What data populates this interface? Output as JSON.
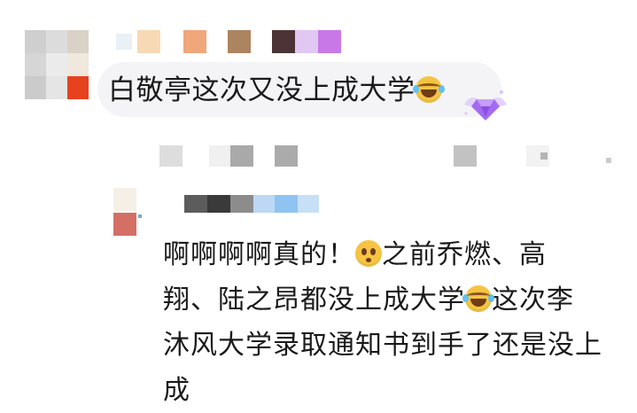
{
  "comment": {
    "text": "白敬亭这次又没上成大学",
    "emoji": "laugh-cry-emoji"
  },
  "reply": {
    "lines": [
      [
        "啊啊啊啊真的！",
        "之前乔燃、高"
      ],
      [
        "翔、陆之昂都没上成大学",
        "这次李"
      ],
      [
        "沐风大学录取通知书到手了还是没上"
      ],
      [
        "成"
      ]
    ]
  },
  "colors": {
    "bubble_bg": "#f4f4f7",
    "text": "#1a1a1a",
    "emoji_yellow": "#f6c443",
    "badge_purple": "#a46bf0"
  }
}
